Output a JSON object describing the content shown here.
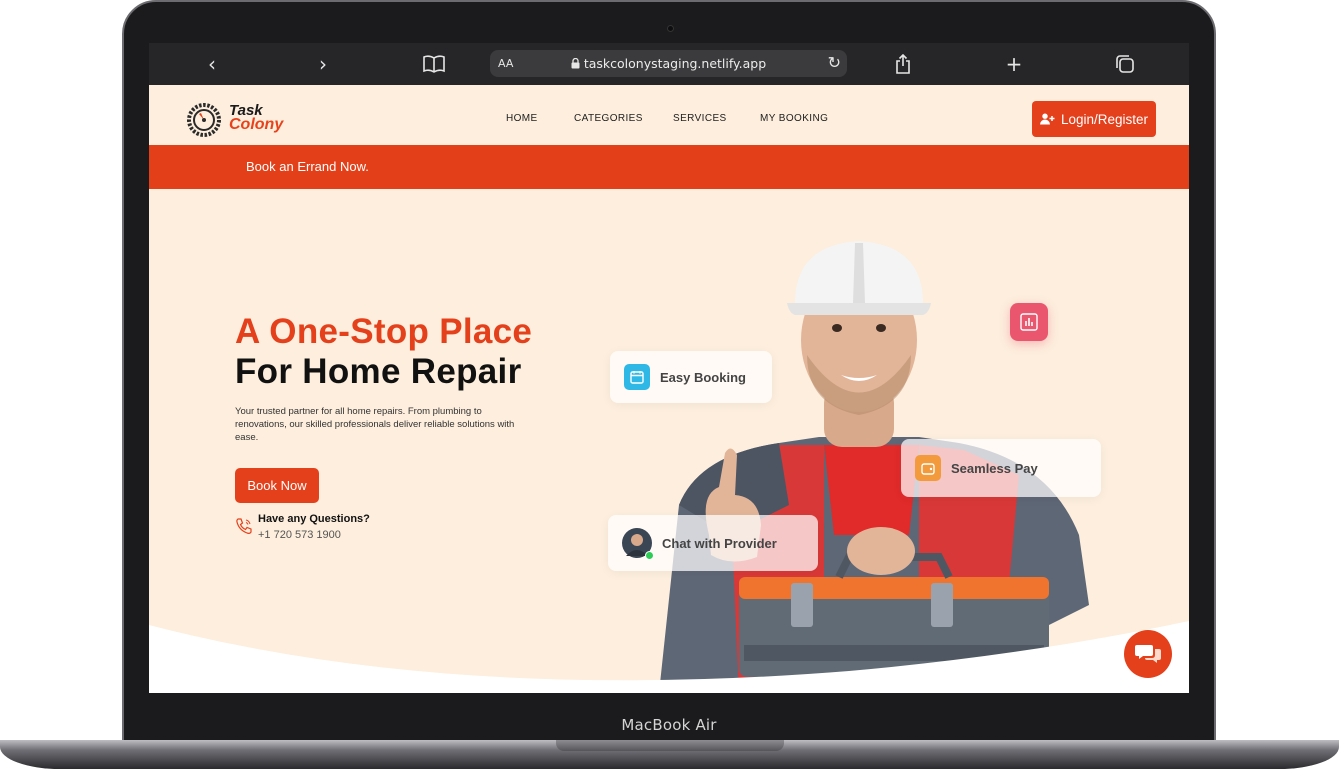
{
  "device": {
    "label": "MacBook Air"
  },
  "browser": {
    "back_icon": "chevron-left-icon",
    "forward_icon": "chevron-right-icon",
    "reader_icon": "book-icon",
    "text_size_label": "AA",
    "url": "taskcolonystaging.netlify.app",
    "lock_icon": "lock-icon",
    "reload_icon": "reload-icon",
    "share_icon": "share-icon",
    "new_tab_icon": "plus-icon",
    "tabs_icon": "tabs-icon"
  },
  "site": {
    "logo": {
      "line1": "Task",
      "line2": "Colony"
    },
    "nav": [
      "HOME",
      "CATEGORIES",
      "SERVICES",
      "MY BOOKING"
    ],
    "login_label": "Login/Register",
    "promo_text": "Book an Errand Now.",
    "hero": {
      "title_line1": "A One-Stop Place",
      "title_line2": "For Home Repair",
      "description": "Your trusted partner for all home repairs. From plumbing to renovations, our skilled professionals deliver reliable solutions with ease.",
      "cta_label": "Book Now",
      "question_label": "Have any Questions?",
      "phone": "+1 720 573 1900"
    },
    "features": {
      "easy_booking": "Easy Booking",
      "seamless_pay": "Seamless Pay",
      "chat_provider": "Chat with Provider"
    },
    "colors": {
      "accent": "#e4401b",
      "background": "#fdeedd",
      "stat_card": "#e9566e"
    }
  }
}
